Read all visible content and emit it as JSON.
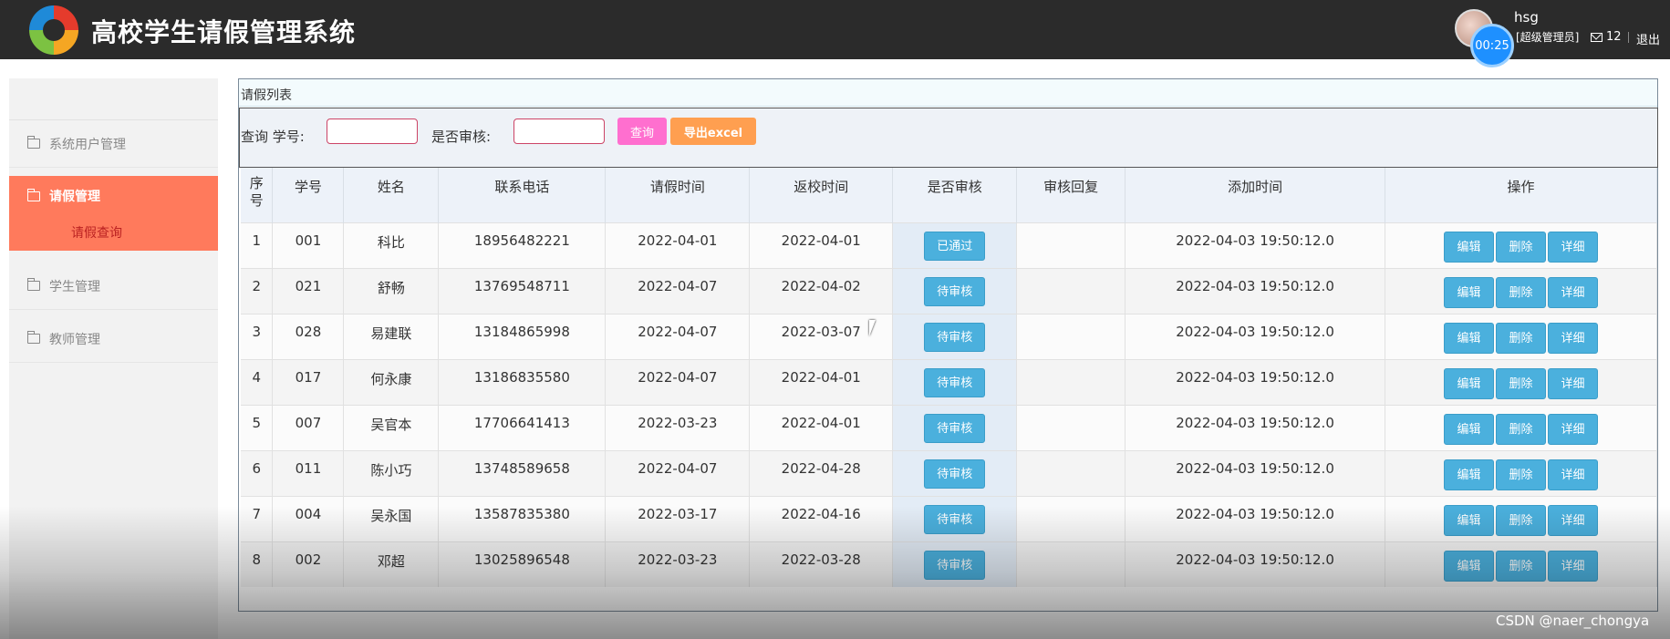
{
  "header": {
    "title": "高校学生请假管理系统",
    "timer": "00:25",
    "username": "hsg",
    "role": "[超级管理员]",
    "message_count": "12",
    "logout": "退出"
  },
  "sidebar": {
    "items": [
      {
        "label": "系统用户管理",
        "icon": "folder-icon"
      },
      {
        "label": "请假管理",
        "icon": "folder-icon",
        "active": true,
        "sub": "请假查询"
      },
      {
        "label": "学生管理",
        "icon": "folder-icon"
      },
      {
        "label": "教师管理",
        "icon": "folder-icon"
      }
    ],
    "active_color": "#ff7a5c"
  },
  "panel": {
    "title": "请假列表",
    "search": {
      "query_label": "查询 学号:",
      "status_label": "是否审核:",
      "query_button": "查询",
      "export_button": "导出excel"
    },
    "table": {
      "headers": [
        "序号",
        "学号",
        "姓名",
        "联系电话",
        "请假时间",
        "返校时间",
        "是否审核",
        "审核回复",
        "添加时间",
        "操作"
      ],
      "rows": [
        [
          "1",
          "001",
          "科比",
          "18956482221",
          "2022-04-01",
          "2022-04-01",
          "已通过",
          "",
          "2022-04-03 19:50:12.0"
        ],
        [
          "2",
          "021",
          "舒畅",
          "13769548711",
          "2022-04-07",
          "2022-04-02",
          "待审核",
          "",
          "2022-04-03 19:50:12.0"
        ],
        [
          "3",
          "028",
          "易建联",
          "13184865998",
          "2022-04-07",
          "2022-03-07",
          "待审核",
          "",
          "2022-04-03 19:50:12.0"
        ],
        [
          "4",
          "017",
          "何永康",
          "13186835580",
          "2022-04-07",
          "2022-04-01",
          "待审核",
          "",
          "2022-04-03 19:50:12.0"
        ],
        [
          "5",
          "007",
          "吴官本",
          "17706641413",
          "2022-03-23",
          "2022-04-01",
          "待审核",
          "",
          "2022-04-03 19:50:12.0"
        ],
        [
          "6",
          "011",
          "陈小巧",
          "13748589658",
          "2022-04-07",
          "2022-04-28",
          "待审核",
          "",
          "2022-04-03 19:50:12.0"
        ],
        [
          "7",
          "004",
          "吴永国",
          "13587835380",
          "2022-03-17",
          "2022-04-16",
          "待审核",
          "",
          "2022-04-03 19:50:12.0"
        ],
        [
          "8",
          "002",
          "邓超",
          "13025896548",
          "2022-03-23",
          "2022-03-28",
          "待审核",
          "",
          "2022-04-03 19:50:12.0"
        ]
      ],
      "actions": [
        "编辑",
        "删除",
        "详细"
      ]
    }
  },
  "watermark": "CSDN @naer_chongya"
}
